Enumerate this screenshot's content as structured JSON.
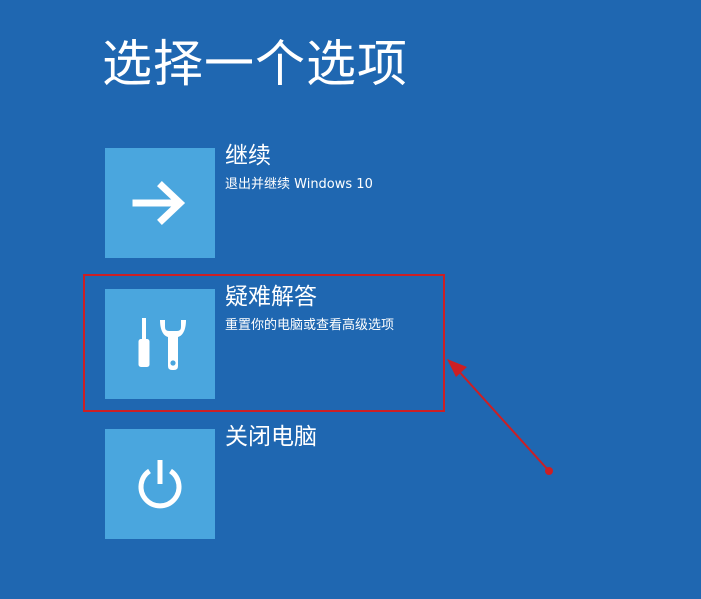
{
  "page": {
    "title": "选择一个选项"
  },
  "options": [
    {
      "label": "继续",
      "description": "退出并继续 Windows 10",
      "icon": "arrow-right-icon"
    },
    {
      "label": "疑难解答",
      "description": "重置你的电脑或查看高级选项",
      "icon": "tools-icon"
    },
    {
      "label": "关闭电脑",
      "description": "",
      "icon": "power-icon"
    }
  ],
  "colors": {
    "background": "#1f67b1",
    "tile": "#4aa6de",
    "annotation": "#cc1f24",
    "text": "#ffffff"
  }
}
